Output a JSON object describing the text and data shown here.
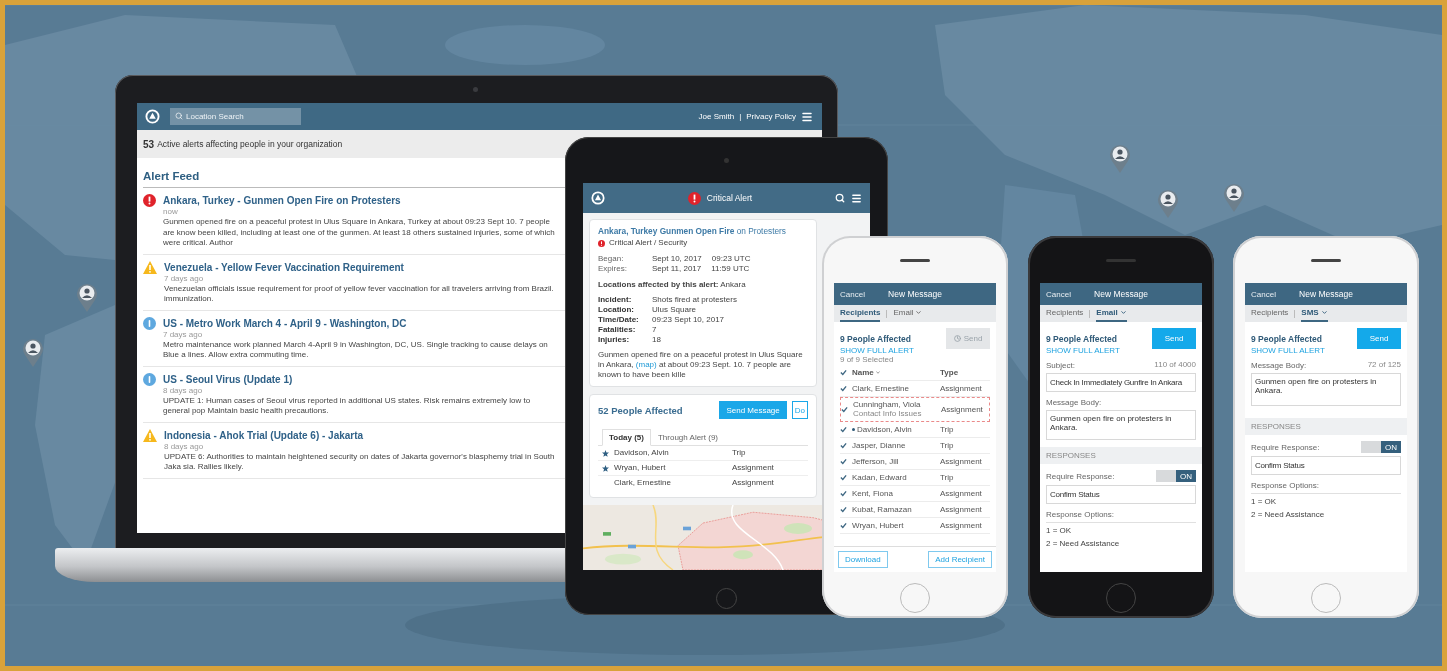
{
  "laptop": {
    "search": {
      "placeholder": "Location Search"
    },
    "user": "Joe Smith",
    "divider": "|",
    "privacy_link": "Privacy Policy",
    "summary": {
      "count": "53",
      "text": "Active alerts affecting people in your organization"
    },
    "feed_title": "Alert Feed",
    "alerts": [
      {
        "kind": "critical",
        "title": "Ankara, Turkey - Gunmen Open Fire on Protesters",
        "time": "now",
        "text": "Gunmen opened fire on a peaceful protest in Ulus Square in Ankara, Turkey at about 09:23 Sept 10. 7 people are know been killed, including at least one of the gunmen. At least 18 others sustained injuries, some of which were critical. Author"
      },
      {
        "kind": "warning",
        "title": "Venezuela - Yellow Fever Vaccination Requirement",
        "time": "7 days ago",
        "text": "Venezuelan officials issue requirement for proof of yellow fever vaccination for all travelers arriving from Brazil. immunization."
      },
      {
        "kind": "info",
        "title": "US - Metro Work March 4 - April 9 - Washington, DC",
        "time": "7 days ago",
        "text": "Metro maintenance work planned March 4-April 9 in Washington, DC, US. Single tracking to cause delays on Blue a lines. Allow extra commuting time."
      },
      {
        "kind": "info",
        "title": "US - Seoul Virus (Update 1)",
        "time": "8 days ago",
        "text": "UPDATE 1: Human cases of Seoul virus reported in additional US states. Risk remains extremely low to general pop Maintain basic health precautions."
      },
      {
        "kind": "warning",
        "title": "Indonesia - Ahok Trial (Update 6) - Jakarta",
        "time": "8 days ago",
        "text": "UPDATE 6: Authorities to maintain heightened security on dates of Jakarta governor's blasphemy trial in South Jaka sia. Rallies likely."
      }
    ]
  },
  "tablet": {
    "title": "Critical Alert",
    "alert": {
      "title": "**Ankara, Turkey Gunmen Open Fire** on Protesters",
      "category": "Critical Alert / Security",
      "dates": [
        {
          "label": "Began:",
          "date": "Sept 10, 2017",
          "time": "09:23 UTC"
        },
        {
          "label": "Expires:",
          "date": "Sept 11, 2017",
          "time": "11:59 UTC"
        }
      ],
      "locations": "**Locations affected by this alert:** Ankara",
      "details": [
        {
          "label": "Incident:",
          "value": "Shots fired at protesters"
        },
        {
          "label": "Location:",
          "value": "Ulus Square"
        },
        {
          "label": "Time/Date:",
          "value": "09:23 Sept 10, 2017"
        },
        {
          "label": "Fatalities:",
          "value": "7"
        },
        {
          "label": "Injuries:",
          "value": "18"
        }
      ],
      "paragraph": "Gunmen opened fire on a peaceful protest in Ulus Square in Ankara,",
      "map_link": "(map)",
      "paragraph_end": "at about 09:23 Sept. 10. 7 people are known to have been kille"
    },
    "affected": {
      "title": "52 People Affected",
      "buttons": [
        "Send Message",
        "Do"
      ],
      "tabs": [
        {
          "label": "Today (5)",
          "selected": true
        },
        {
          "label": "Through Alert (9)",
          "selected": false
        }
      ],
      "rows": [
        {
          "name": "Davidson, Alvin",
          "type": "Trip",
          "starred": true
        },
        {
          "name": "Wryan, Hubert",
          "type": "Assignment",
          "starred": true
        },
        {
          "name": "Clark, Ernestine",
          "type": "Assignment",
          "starred": false
        }
      ]
    }
  },
  "phones": [
    {
      "kind": "recipients",
      "cancel": "Cancel",
      "title": "New Message",
      "tabs": [
        {
          "label": "Recipients",
          "selected": true,
          "dropdown": false
        },
        {
          "label": "Email",
          "selected": false,
          "dropdown": true
        }
      ],
      "affected": "9 People Affected",
      "show_alert": "SHOW FULL ALERT",
      "send": {
        "label": "Send",
        "disabled": true
      },
      "selected_count": "9 of 9 Selected",
      "header": {
        "checked": true,
        "name": "Name",
        "type": "Type"
      },
      "rows": [
        {
          "name": "Clark, Ernestine",
          "type": "Assignment",
          "checked": true,
          "starred": false,
          "flagged": false
        },
        {
          "name": "Cunningham, Viola",
          "note": "Contact Info Issues",
          "type": "Assignment",
          "checked": true,
          "starred": false,
          "flagged": true
        },
        {
          "name": "Davidson, Alvin",
          "type": "Trip",
          "checked": true,
          "starred": true,
          "flagged": false
        },
        {
          "name": "Jasper, Dianne",
          "type": "Trip",
          "checked": true,
          "starred": false,
          "flagged": false
        },
        {
          "name": "Jefferson, Jill",
          "type": "Assignment",
          "checked": true,
          "starred": false,
          "flagged": false
        },
        {
          "name": "Kadan, Edward",
          "type": "Trip",
          "checked": true,
          "starred": false,
          "flagged": false
        },
        {
          "name": "Kent, Fiona",
          "type": "Assignment",
          "checked": true,
          "starred": false,
          "flagged": false
        },
        {
          "name": "Kubat, Ramazan",
          "type": "Assignment",
          "checked": true,
          "starred": false,
          "flagged": false
        },
        {
          "name": "Wryan, Hubert",
          "type": "Assignment",
          "checked": true,
          "starred": false,
          "flagged": false
        }
      ],
      "footer_buttons": [
        "Download",
        "Add Recipient"
      ]
    },
    {
      "kind": "email",
      "cancel": "Cancel",
      "title": "New Message",
      "tabs": [
        {
          "label": "Recipients",
          "selected": false,
          "dropdown": false
        },
        {
          "label": "Email",
          "selected": true,
          "dropdown": true
        }
      ],
      "affected": "9 People Affected",
      "show_alert": "SHOW FULL ALERT",
      "send": {
        "label": "Send",
        "disabled": false
      },
      "subject": {
        "label": "Subject:",
        "counter": "110 of 4000",
        "value": "Check In Immediately Gunfire In Ankara"
      },
      "body": {
        "label": "Message Body:",
        "value": "Gunmen open fire on protesters in Ankara."
      },
      "responses": {
        "heading": "RESPONSES",
        "require_label": "Require Response:",
        "toggle": {
          "on": true,
          "label": "ON"
        },
        "response_value": "Confirm Status",
        "options_label": "Response Options:",
        "options": [
          "1 = OK",
          "2 = Need Assistance"
        ]
      }
    },
    {
      "kind": "sms",
      "cancel": "Cancel",
      "title": "New Message",
      "tabs": [
        {
          "label": "Recipients",
          "selected": false,
          "dropdown": false
        },
        {
          "label": "SMS",
          "selected": true,
          "dropdown": true
        }
      ],
      "affected": "9 People Affected",
      "show_alert": "SHOW FULL ALERT",
      "send": {
        "label": "Send",
        "disabled": false
      },
      "body": {
        "label": "Message Body:",
        "counter": "72 of 125",
        "value": "Gunmen open fire on protesters in Ankara."
      },
      "responses": {
        "heading": "RESPONSES",
        "require_label": "Require Response:",
        "toggle": {
          "on": true,
          "label": "ON"
        },
        "response_value": "Confirm Status",
        "options_label": "Response Options:",
        "options": [
          "1 = OK",
          "2 = Need Assistance"
        ]
      }
    }
  ]
}
